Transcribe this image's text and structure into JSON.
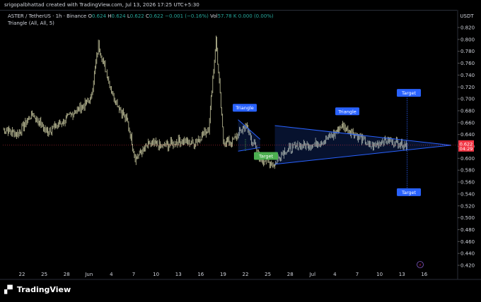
{
  "header": {
    "created_by": "srigopalbhattad created with TradingView.com, Jul 13, 2026 17:25 UTC+5:30"
  },
  "legend": {
    "symbol": "ASTER / TetherUS · 1h · Binance",
    "o_label": "O",
    "o_value": "0.624",
    "h_label": "H",
    "h_value": "0.624",
    "l_label": "L",
    "l_value": "0.622",
    "c_label": "C",
    "c_value": "0.622",
    "change": "−0.001 (−0.16%)",
    "vol_label": "Vol",
    "vol_value": "57.78 K",
    "vol_extra": "0.000 (0.00%)",
    "indicator": "Triangle (All, All, 5)"
  },
  "price_axis": {
    "currency": "USDT",
    "ticks": [
      "0.820",
      "0.800",
      "0.780",
      "0.760",
      "0.740",
      "0.720",
      "0.700",
      "0.680",
      "0.660",
      "0.640",
      "0.620",
      "0.600",
      "0.580",
      "0.560",
      "0.540",
      "0.520",
      "0.500",
      "0.480",
      "0.460",
      "0.440",
      "0.420"
    ],
    "last_price": "0.622",
    "countdown": "04:29"
  },
  "time_axis": {
    "ticks": [
      "22",
      "25",
      "28",
      "Jun",
      "4",
      "7",
      "10",
      "13",
      "16",
      "19",
      "22",
      "25",
      "28",
      "Jul",
      "4",
      "7",
      "10",
      "13",
      "16"
    ]
  },
  "annotations": {
    "triangle_1": "Triangle",
    "triangle_2": "Triangle",
    "target_1": "Target",
    "target_2": "Target",
    "target_3": "Target"
  },
  "brand": {
    "logo_text": "TradingView"
  },
  "colors": {
    "up": "#26a69a",
    "down": "#ef5350",
    "candle": "#c9c9a0",
    "pattern": "#2962ff",
    "target_green": "#4caf50",
    "price_tag": "#f23645"
  },
  "chart_data": {
    "type": "line",
    "title": "",
    "xlabel": "",
    "ylabel": "",
    "ylim": [
      0.41,
      0.83
    ],
    "x_range": [
      "May 19",
      "Jul 19"
    ],
    "x": [
      "May 19",
      "May 21",
      "May 23",
      "May 25",
      "May 27",
      "May 29",
      "May 31",
      "Jun 1",
      "Jun 3",
      "Jun 5",
      "Jun 6",
      "Jun 8",
      "Jun 10",
      "Jun 12",
      "Jun 14",
      "Jun 16",
      "Jun 17",
      "Jun 18",
      "Jun 19",
      "Jun 21",
      "Jun 23",
      "Jun 25",
      "Jun 26",
      "Jun 28",
      "Jul 1",
      "Jul 3",
      "Jul 4",
      "Jul 6",
      "Jul 8",
      "Jul 10",
      "Jul 12",
      "Jul 13"
    ],
    "series": [
      {
        "values": [
          0.65,
          0.64,
          0.675,
          0.645,
          0.66,
          0.68,
          0.7,
          0.79,
          0.705,
          0.66,
          0.6,
          0.625,
          0.62,
          0.63,
          0.625,
          0.65,
          0.8,
          0.63,
          0.625,
          0.655,
          0.6,
          0.59,
          0.61,
          0.62,
          0.625,
          0.64,
          0.655,
          0.64,
          0.62,
          0.63,
          0.625,
          0.622
        ]
      }
    ],
    "price_range": {
      "min": 0.59,
      "max": 0.8
    },
    "patterns": [
      {
        "label": "Triangle",
        "apex": "Jun 23",
        "upper": [
          0.665,
          0.632
        ],
        "lower": [
          0.612,
          0.618
        ]
      },
      {
        "label": "Triangle",
        "start": "Jun 25",
        "apex": "Jul 19",
        "upper": [
          0.655,
          0.622
        ],
        "lower": [
          0.59,
          0.622
        ]
      }
    ],
    "targets": [
      0.705,
      0.548,
      0.612
    ],
    "last_price": 0.622
  }
}
